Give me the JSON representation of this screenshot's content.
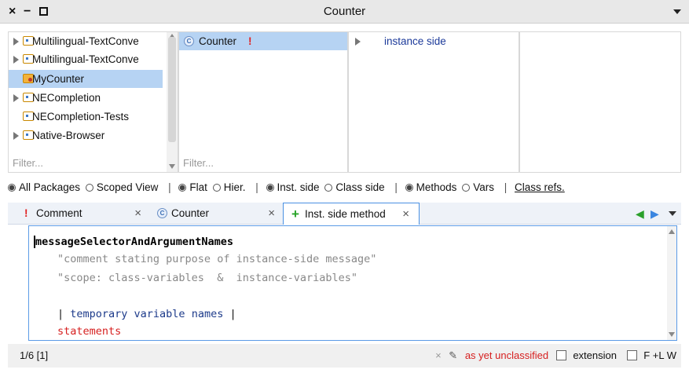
{
  "window": {
    "title": "Counter",
    "close_glyph": "×",
    "minimize_glyph": "−"
  },
  "packages": {
    "items": [
      {
        "label": "Multilingual-TextConve",
        "expandable": true,
        "selected": false
      },
      {
        "label": "Multilingual-TextConve",
        "expandable": true,
        "selected": false
      },
      {
        "label": "MyCounter",
        "expandable": false,
        "selected": true
      },
      {
        "label": "NECompletion",
        "expandable": true,
        "selected": false
      },
      {
        "label": "NECompletion-Tests",
        "expandable": false,
        "selected": false
      },
      {
        "label": "Native-Browser",
        "expandable": true,
        "selected": false
      }
    ],
    "filter_placeholder": "Filter..."
  },
  "classes": {
    "items": [
      {
        "badge": "C",
        "label": "Counter",
        "flag": "!",
        "selected": true
      }
    ],
    "filter_placeholder": "Filter..."
  },
  "protocols": {
    "items": [
      {
        "label": "instance side"
      }
    ]
  },
  "options": {
    "all_packages": "All Packages",
    "scoped_view": "Scoped View",
    "flat": "Flat",
    "hier": "Hier.",
    "inst_side": "Inst. side",
    "class_side": "Class side",
    "methods": "Methods",
    "vars": "Vars",
    "class_refs": "Class refs.",
    "separator": "|"
  },
  "tabs": [
    {
      "icon": "!",
      "label": "Comment",
      "close": "×"
    },
    {
      "icon": "C",
      "label": "Counter",
      "close": "×"
    },
    {
      "icon": "+",
      "label": "Inst. side method",
      "close": "×",
      "active": true
    }
  ],
  "editor": {
    "selector": "messageSelectorAndArgumentNames",
    "comment1": "\"comment stating purpose of instance-side message\"",
    "comment2": "\"scope: class-variables  &  instance-variables\"",
    "bar_open": "| ",
    "temps": "temporary variable names",
    "bar_close": " |",
    "statements": "statements"
  },
  "status": {
    "position": "1/6 [1]",
    "close_glyph": "×",
    "protocol": "as yet unclassified",
    "extension": "extension",
    "flags": "F  +L  W"
  },
  "colors": {
    "accent": "#4a90e2",
    "selection": "#b6d3f3",
    "error": "#d62020"
  }
}
